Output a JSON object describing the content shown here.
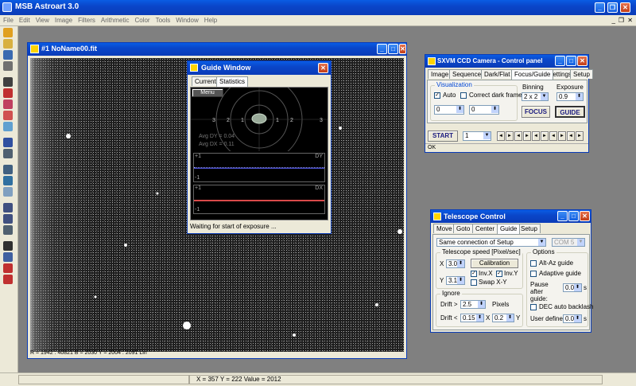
{
  "app": {
    "title": "MSB Astroart 3.0"
  },
  "menu": [
    "File",
    "Edit",
    "View",
    "Image",
    "Filters",
    "Arithmetic",
    "Color",
    "Tools",
    "Window",
    "Help"
  ],
  "colors": {
    "titlebar": "#0a4ecf",
    "desktop": "#808080",
    "accent_red": "#c33e18"
  },
  "toolbar": {
    "icons": [
      "open-icon",
      "open-folder-icon",
      "save-icon",
      "print-icon",
      "camera-icon",
      "rotate-icon",
      "palette-icon",
      "filter-icon",
      "color-icon",
      "disk-icon",
      "zoom-in-icon",
      "histogram-icon",
      "curve-icon",
      "flip-icon",
      "zoom-in-icon",
      "zoom-out-icon",
      "fit-icon",
      "sum-icon",
      "stack-icon",
      "crosshair-icon",
      "align-icon"
    ]
  },
  "image_window": {
    "title": "#1  NoName00.fit",
    "info": "R = 1942 : 40821   B = 2030   Y = 2004 : 2091 Lin"
  },
  "status": {
    "text": "X = 357   Y = 222   Value = 2012"
  },
  "guide": {
    "title": "Guide Window",
    "tabs": [
      "Current",
      "Statistics"
    ],
    "menu": "Menu",
    "rings": [
      "3",
      "2",
      "1",
      "1",
      "2",
      "3"
    ],
    "avg_dy": "Avg DY = 0.04",
    "avg_dx": "Avg DX = 0.11",
    "dy_plus": "+1",
    "dy_minus": "-1",
    "dy_label": "DY",
    "dx_plus": "+1",
    "dx_minus": "-1",
    "dx_label": "DX",
    "status": "Waiting for start of exposure ..."
  },
  "camera": {
    "title": "SXVM CCD Camera - Control panel",
    "tabs": [
      "Image",
      "Sequence",
      "Dark/Flat",
      "Focus/Guide",
      "Settings",
      "Setup"
    ],
    "visualization": "Visualization",
    "auto": "Auto",
    "correct_dark": "Correct dark frame",
    "vmin": "0",
    "vmax": "0",
    "binning_label": "Binning",
    "binning": "2 x 2",
    "exposure_label": "Exposure",
    "exposure": "0.9",
    "focus": "FOCUS",
    "guide": "GUIDE",
    "start": "START",
    "count": "1",
    "arrows": [
      "◄",
      "►",
      "◄",
      "►",
      "◄",
      "►",
      "◄",
      "►",
      "◄",
      "►"
    ],
    "status": "OK"
  },
  "telescope": {
    "title": "Telescope Control",
    "tabs": [
      "Move",
      "Goto",
      "Center",
      "Guide",
      "Setup"
    ],
    "connection": "Same connection of Setup",
    "port": "COM 5",
    "speed_label": "Telescope speed  [Pixel/sec]",
    "x_label": "X",
    "x_val": "3.0",
    "y_label": "Y",
    "y_val": "3.1",
    "calibration": "Calibration",
    "invx": "Inv.X",
    "invy": "Inv.Y",
    "swap": "Swap X-Y",
    "ignore": "Ignore",
    "drift_gt": "Drift >",
    "drift_gt_val": "2.5",
    "pixels": "Pixels",
    "drift_lt": "Drift <",
    "drift_lt_x": "0.15",
    "x2": "X",
    "drift_lt_y": "0.2",
    "y2": "Y",
    "options": "Options",
    "altaz": "Alt-Az guide",
    "adaptive": "Adaptive guide",
    "pause_label": "Pause after guide:",
    "pause_val": "0.0",
    "s1": "s",
    "dec": "DEC auto backlash",
    "user_label": "User defined:",
    "user_val": "0.0",
    "s2": "s"
  }
}
